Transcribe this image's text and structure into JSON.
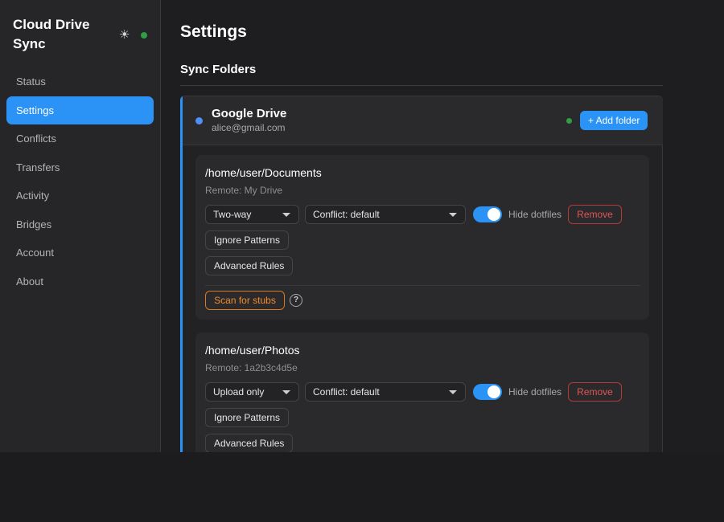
{
  "app": {
    "title": "Cloud Drive Sync",
    "theme_icon": "sun-icon",
    "connection_status_color": "#2f9e44"
  },
  "sidebar": {
    "items": [
      {
        "label": "Status",
        "active": false
      },
      {
        "label": "Settings",
        "active": true
      },
      {
        "label": "Conflicts",
        "active": false
      },
      {
        "label": "Transfers",
        "active": false
      },
      {
        "label": "Activity",
        "active": false
      },
      {
        "label": "Bridges",
        "active": false
      },
      {
        "label": "Account",
        "active": false
      },
      {
        "label": "About",
        "active": false
      }
    ]
  },
  "main": {
    "title": "Settings",
    "section_title": "Sync Folders",
    "provider": {
      "name": "Google Drive",
      "email": "alice@gmail.com",
      "add_label": "+ Add folder",
      "accent_color": "#2b93f5",
      "folders": [
        {
          "path": "/home/user/Documents",
          "remote": "Remote: My Drive",
          "mode": "Two-way",
          "conflict": "Conflict: default",
          "hide_dotfiles": true,
          "hide_dotfiles_label": "Hide dotfiles",
          "remove_label": "Remove",
          "ignore_label": "Ignore Patterns",
          "advanced_label": "Advanced Rules",
          "scan_label": "Scan for stubs",
          "help": "?"
        },
        {
          "path": "/home/user/Photos",
          "remote": "Remote: 1a2b3c4d5e",
          "mode": "Upload only",
          "conflict": "Conflict: default",
          "hide_dotfiles": true,
          "hide_dotfiles_label": "Hide dotfiles",
          "remove_label": "Remove",
          "ignore_label": "Ignore Patterns",
          "advanced_label": "Advanced Rules"
        }
      ]
    }
  }
}
